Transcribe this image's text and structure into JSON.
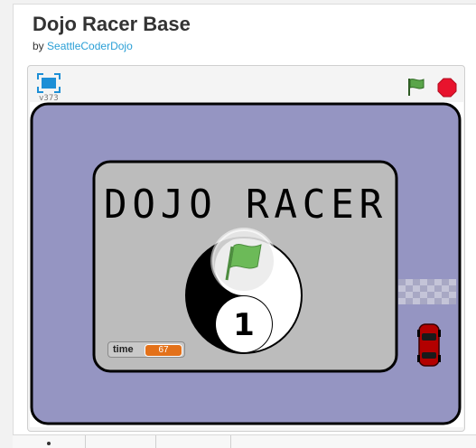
{
  "project": {
    "title": "Dojo Racer Base",
    "by_label": "by",
    "author": "SeattleCoderDojo"
  },
  "player": {
    "version": "v373",
    "fullscreen_icon": "fullscreen-icon",
    "green_flag_icon": "green-flag-icon",
    "stop_icon": "stop-icon"
  },
  "stage": {
    "game_title": "DOJO RACER",
    "level_number": "1",
    "variable_monitor": {
      "name": "time",
      "value": "67"
    }
  },
  "colors": {
    "track": "#9595c2",
    "title_card": "#bcbcbc",
    "car": "#b30000",
    "flag_green": "#5aa54a",
    "stop_red": "#e8132d",
    "monitor_value": "#e3711a",
    "link": "#2a9fd6"
  }
}
